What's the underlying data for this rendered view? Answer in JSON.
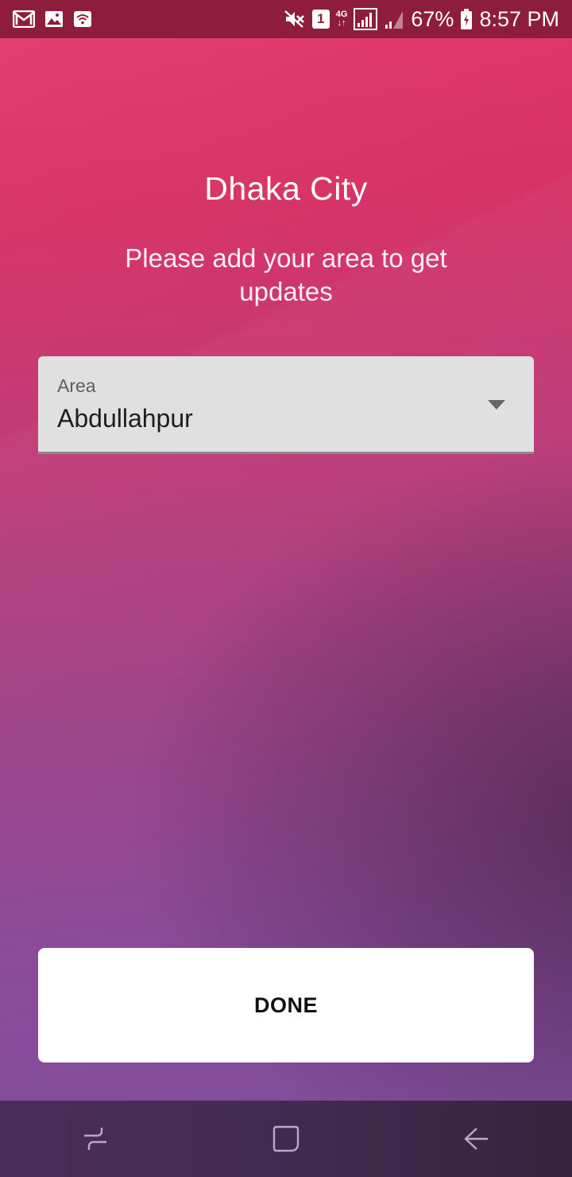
{
  "status_bar": {
    "battery_percent": "67%",
    "time": "8:57 PM",
    "sim_slot": "1",
    "network_type": "4G",
    "icons": [
      "gmail-icon",
      "gallery-icon",
      "wifi-icon",
      "mute-icon",
      "sim-icon",
      "signal-icon",
      "signal-icon",
      "battery-icon"
    ]
  },
  "main": {
    "title": "Dhaka City",
    "subtitle": "Please add your area to get updates",
    "area_select": {
      "label": "Area",
      "value": "Abdullahpur"
    },
    "done_label": "DONE"
  },
  "nav_bar": {
    "icons": [
      "recent-apps-icon",
      "home-icon",
      "back-icon"
    ]
  },
  "colors": {
    "status_bar": "#8e1d3c",
    "gradient_top": "#e2356a",
    "gradient_bottom": "#7e4f9e",
    "dropdown_bg": "#e0e0e0",
    "button_bg": "#ffffff"
  }
}
